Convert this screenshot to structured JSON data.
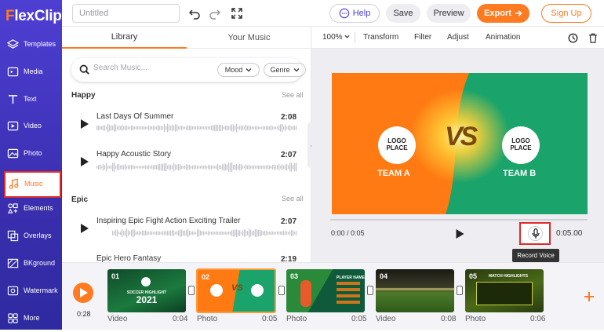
{
  "app": {
    "logo_prefix": "F",
    "logo_text": "lexClip"
  },
  "sidebar": {
    "items": [
      {
        "label": "Templates",
        "icon": "layers-icon"
      },
      {
        "label": "Media",
        "icon": "media-icon"
      },
      {
        "label": "Text",
        "icon": "text-icon"
      },
      {
        "label": "Video",
        "icon": "video-icon"
      },
      {
        "label": "Photo",
        "icon": "photo-icon"
      },
      {
        "label": "Music",
        "icon": "music-icon",
        "active": true
      },
      {
        "label": "Elements",
        "icon": "elements-icon"
      },
      {
        "label": "Overlays",
        "icon": "overlays-icon"
      },
      {
        "label": "BKground",
        "icon": "background-icon"
      },
      {
        "label": "Watermark",
        "icon": "watermark-icon"
      },
      {
        "label": "More",
        "icon": "more-icon"
      }
    ]
  },
  "topbar": {
    "title_placeholder": "Untitled",
    "help_label": "Help",
    "save_label": "Save",
    "preview_label": "Preview",
    "export_label": "Export",
    "signup_label": "Sign Up"
  },
  "library": {
    "tabs": [
      "Library",
      "Your Music"
    ],
    "search_placeholder": "Search Music...",
    "mood_label": "Mood",
    "genre_label": "Genre",
    "see_all": "See all",
    "sections": [
      {
        "title": "Happy",
        "tracks": [
          {
            "title": "Last Days Of Summer",
            "duration": "2:08"
          },
          {
            "title": "Happy Acoustic Story",
            "duration": "2:07"
          }
        ]
      },
      {
        "title": "Epic",
        "tracks": [
          {
            "title": "Inspiring Epic Fight Action Exciting Trailer",
            "duration": "2:07"
          },
          {
            "title": "Epic Hero Fantasy",
            "duration": "2:19"
          }
        ]
      }
    ]
  },
  "properties": {
    "zoom": "100%",
    "items": [
      "Transform",
      "Filter",
      "Adjust",
      "Animation"
    ]
  },
  "stage": {
    "logo_text_line1": "LOGO",
    "logo_text_line2": "PLACE",
    "team_a": "TEAM A",
    "team_b": "TEAM B",
    "vs": "VS",
    "colors": {
      "left": "#ff7a12",
      "right": "#1aa36b"
    }
  },
  "player": {
    "time": "0:00 / 0:05",
    "total": "0:05.00",
    "tooltip": "Record Voice"
  },
  "timeline": {
    "current": "0:28",
    "clips": [
      {
        "num": "01",
        "type": "Video",
        "dur": "0:04",
        "caption": "SOCCER HIGHLIGHT",
        "year": "2021"
      },
      {
        "num": "02",
        "type": "Photo",
        "dur": "0:05",
        "selected": true
      },
      {
        "num": "03",
        "type": "Photo",
        "dur": "0:05",
        "caption": "PLAYER NAME"
      },
      {
        "num": "04",
        "type": "Video",
        "dur": "0:08"
      },
      {
        "num": "05",
        "type": "Photo",
        "dur": "0:06",
        "caption": "MATCH HIGHLIGHTS"
      }
    ]
  },
  "colors": {
    "accent": "#ff7b22",
    "brand": "#4b3fd0",
    "highlight": "#e02a2a"
  }
}
